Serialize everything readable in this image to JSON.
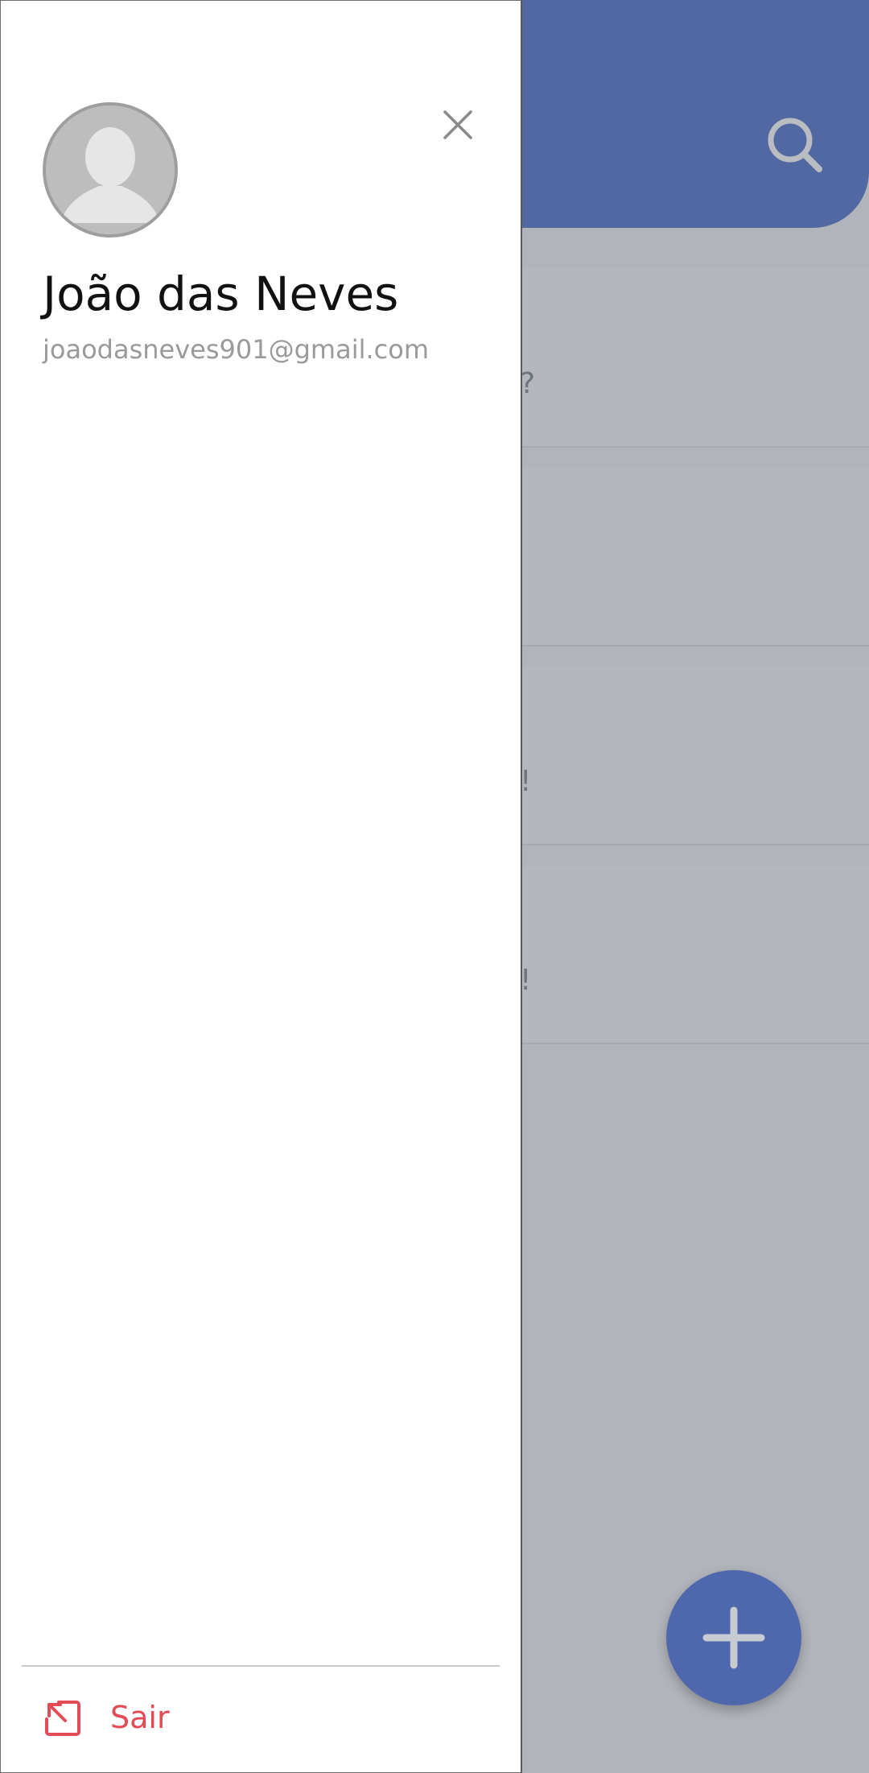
{
  "background": {
    "cards": [
      {
        "tail_text": "?"
      },
      {
        "tail_text": ""
      },
      {
        "tail_text": "!"
      },
      {
        "tail_text": "!"
      }
    ],
    "header_icon": "search-icon",
    "fab_icon": "plus-icon"
  },
  "drawer": {
    "close_icon": "close-icon",
    "avatar_icon": "default-avatar-icon",
    "user": {
      "name": "João das Neves",
      "email": "joaodasneves901@gmail.com"
    },
    "logout": {
      "label": "Sair",
      "icon": "logout-icon"
    }
  },
  "colors": {
    "header": "#5b7ad0",
    "fab": "#4f68ad",
    "logout": "#e34b57"
  }
}
